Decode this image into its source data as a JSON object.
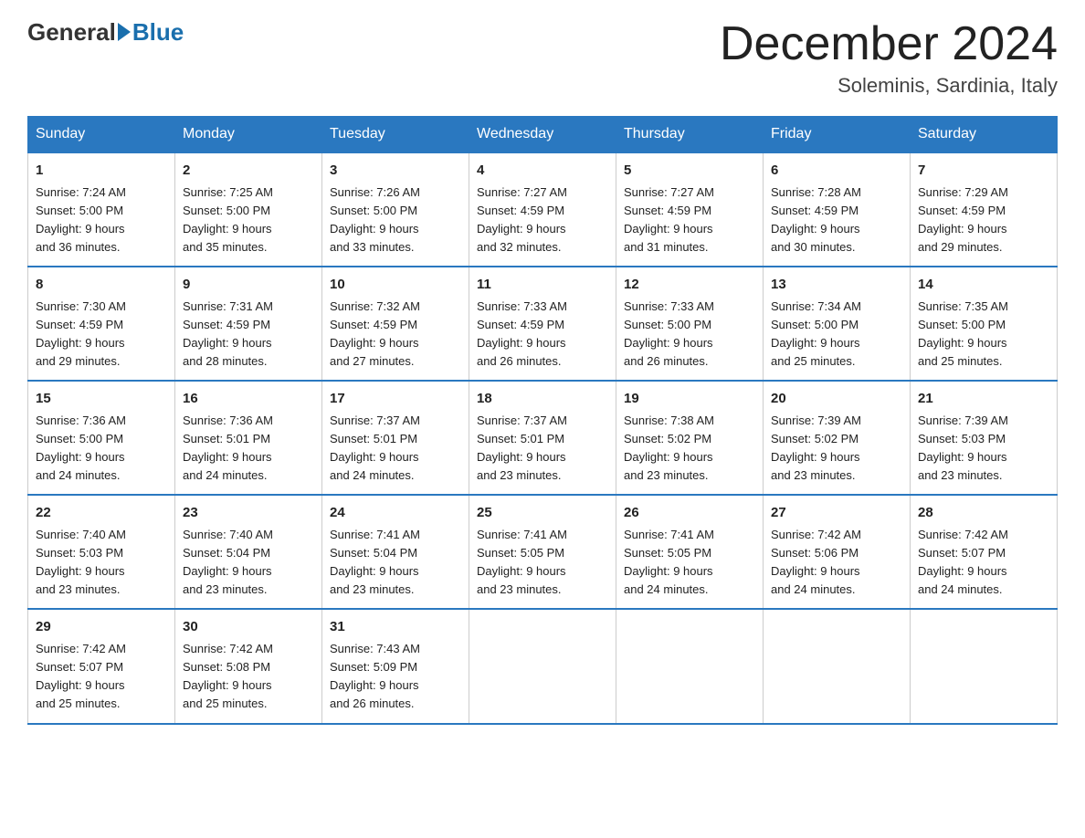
{
  "header": {
    "logo_general": "General",
    "logo_blue": "Blue",
    "month_title": "December 2024",
    "location": "Soleminis, Sardinia, Italy"
  },
  "days_of_week": [
    "Sunday",
    "Monday",
    "Tuesday",
    "Wednesday",
    "Thursday",
    "Friday",
    "Saturday"
  ],
  "weeks": [
    [
      {
        "day": "1",
        "sunrise": "7:24 AM",
        "sunset": "5:00 PM",
        "daylight": "9 hours and 36 minutes."
      },
      {
        "day": "2",
        "sunrise": "7:25 AM",
        "sunset": "5:00 PM",
        "daylight": "9 hours and 35 minutes."
      },
      {
        "day": "3",
        "sunrise": "7:26 AM",
        "sunset": "5:00 PM",
        "daylight": "9 hours and 33 minutes."
      },
      {
        "day": "4",
        "sunrise": "7:27 AM",
        "sunset": "4:59 PM",
        "daylight": "9 hours and 32 minutes."
      },
      {
        "day": "5",
        "sunrise": "7:27 AM",
        "sunset": "4:59 PM",
        "daylight": "9 hours and 31 minutes."
      },
      {
        "day": "6",
        "sunrise": "7:28 AM",
        "sunset": "4:59 PM",
        "daylight": "9 hours and 30 minutes."
      },
      {
        "day": "7",
        "sunrise": "7:29 AM",
        "sunset": "4:59 PM",
        "daylight": "9 hours and 29 minutes."
      }
    ],
    [
      {
        "day": "8",
        "sunrise": "7:30 AM",
        "sunset": "4:59 PM",
        "daylight": "9 hours and 29 minutes."
      },
      {
        "day": "9",
        "sunrise": "7:31 AM",
        "sunset": "4:59 PM",
        "daylight": "9 hours and 28 minutes."
      },
      {
        "day": "10",
        "sunrise": "7:32 AM",
        "sunset": "4:59 PM",
        "daylight": "9 hours and 27 minutes."
      },
      {
        "day": "11",
        "sunrise": "7:33 AM",
        "sunset": "4:59 PM",
        "daylight": "9 hours and 26 minutes."
      },
      {
        "day": "12",
        "sunrise": "7:33 AM",
        "sunset": "5:00 PM",
        "daylight": "9 hours and 26 minutes."
      },
      {
        "day": "13",
        "sunrise": "7:34 AM",
        "sunset": "5:00 PM",
        "daylight": "9 hours and 25 minutes."
      },
      {
        "day": "14",
        "sunrise": "7:35 AM",
        "sunset": "5:00 PM",
        "daylight": "9 hours and 25 minutes."
      }
    ],
    [
      {
        "day": "15",
        "sunrise": "7:36 AM",
        "sunset": "5:00 PM",
        "daylight": "9 hours and 24 minutes."
      },
      {
        "day": "16",
        "sunrise": "7:36 AM",
        "sunset": "5:01 PM",
        "daylight": "9 hours and 24 minutes."
      },
      {
        "day": "17",
        "sunrise": "7:37 AM",
        "sunset": "5:01 PM",
        "daylight": "9 hours and 24 minutes."
      },
      {
        "day": "18",
        "sunrise": "7:37 AM",
        "sunset": "5:01 PM",
        "daylight": "9 hours and 23 minutes."
      },
      {
        "day": "19",
        "sunrise": "7:38 AM",
        "sunset": "5:02 PM",
        "daylight": "9 hours and 23 minutes."
      },
      {
        "day": "20",
        "sunrise": "7:39 AM",
        "sunset": "5:02 PM",
        "daylight": "9 hours and 23 minutes."
      },
      {
        "day": "21",
        "sunrise": "7:39 AM",
        "sunset": "5:03 PM",
        "daylight": "9 hours and 23 minutes."
      }
    ],
    [
      {
        "day": "22",
        "sunrise": "7:40 AM",
        "sunset": "5:03 PM",
        "daylight": "9 hours and 23 minutes."
      },
      {
        "day": "23",
        "sunrise": "7:40 AM",
        "sunset": "5:04 PM",
        "daylight": "9 hours and 23 minutes."
      },
      {
        "day": "24",
        "sunrise": "7:41 AM",
        "sunset": "5:04 PM",
        "daylight": "9 hours and 23 minutes."
      },
      {
        "day": "25",
        "sunrise": "7:41 AM",
        "sunset": "5:05 PM",
        "daylight": "9 hours and 23 minutes."
      },
      {
        "day": "26",
        "sunrise": "7:41 AM",
        "sunset": "5:05 PM",
        "daylight": "9 hours and 24 minutes."
      },
      {
        "day": "27",
        "sunrise": "7:42 AM",
        "sunset": "5:06 PM",
        "daylight": "9 hours and 24 minutes."
      },
      {
        "day": "28",
        "sunrise": "7:42 AM",
        "sunset": "5:07 PM",
        "daylight": "9 hours and 24 minutes."
      }
    ],
    [
      {
        "day": "29",
        "sunrise": "7:42 AM",
        "sunset": "5:07 PM",
        "daylight": "9 hours and 25 minutes."
      },
      {
        "day": "30",
        "sunrise": "7:42 AM",
        "sunset": "5:08 PM",
        "daylight": "9 hours and 25 minutes."
      },
      {
        "day": "31",
        "sunrise": "7:43 AM",
        "sunset": "5:09 PM",
        "daylight": "9 hours and 26 minutes."
      },
      {
        "day": "",
        "sunrise": "",
        "sunset": "",
        "daylight": ""
      },
      {
        "day": "",
        "sunrise": "",
        "sunset": "",
        "daylight": ""
      },
      {
        "day": "",
        "sunrise": "",
        "sunset": "",
        "daylight": ""
      },
      {
        "day": "",
        "sunrise": "",
        "sunset": "",
        "daylight": ""
      }
    ]
  ],
  "labels": {
    "sunrise": "Sunrise: ",
    "sunset": "Sunset: ",
    "daylight": "Daylight: "
  }
}
